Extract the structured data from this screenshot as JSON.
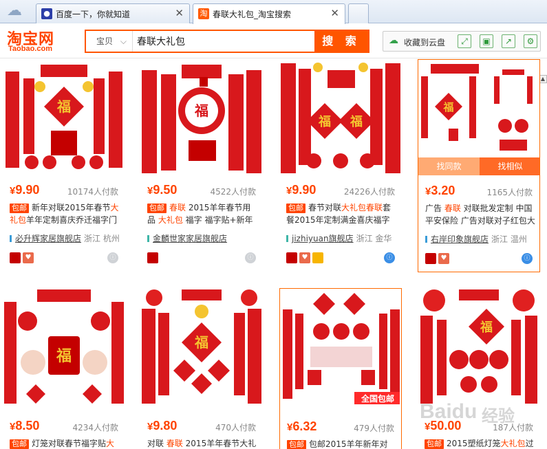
{
  "tabs": [
    {
      "title": "百度一下，你就知道",
      "icon": "baidu-paw-icon"
    },
    {
      "title": "春联大礼包_淘宝搜索",
      "icon": "taobao-icon",
      "active": true
    }
  ],
  "header": {
    "logo_cn": "淘宝网",
    "logo_en": "Taobao.com",
    "category": "宝贝",
    "query": "春联大礼包",
    "search_button": "搜 索",
    "cloud_save": "收藏到云盘"
  },
  "products": [
    {
      "price": "9.90",
      "sales": "10174人付款",
      "tag": "包邮",
      "desc_pre": "新年对联2015年春节",
      "desc_hi": "大",
      "desc_post": "",
      "desc2_hi": "礼包",
      "desc2": "羊年定制喜庆乔迁福字门",
      "shop": "必升辉家居旗舰店",
      "loc": "浙江 杭州",
      "icons": [
        "tmall",
        "heart"
      ],
      "ww": "gray"
    },
    {
      "price": "9.50",
      "sales": "4522人付款",
      "tag": "包邮",
      "desc_pre": "",
      "desc_hi": "春联",
      "desc_post": " 2015羊年春节用品",
      "desc2_hi": "大礼包",
      "desc2": " 福字 福字贴+新年红包",
      "shop": "金麟世家家居旗舰店",
      "loc": "",
      "icons": [
        "tmall"
      ],
      "ww": "gray"
    },
    {
      "price": "9.90",
      "sales": "24226人付款",
      "tag": "包邮",
      "desc_pre": "春节对联",
      "desc_hi": "大礼包春联",
      "desc_post": "套",
      "desc2_hi": "",
      "desc2": "餐2015年定制满金喜庆福字",
      "shop": "jizhiyuan旗舰店",
      "loc": "浙江 金华",
      "icons": [
        "tmall",
        "heart",
        "gold"
      ],
      "ww": "blue"
    },
    {
      "price": "3.20",
      "sales": "1165人付款",
      "tag": "",
      "desc_pre": "广告 ",
      "desc_hi": "春联",
      "desc_post": " 对联批发定制 中国",
      "desc2_hi": "",
      "desc2": "平安保险 广告对联对子红包大",
      "shop": "右岸印象旗舰店",
      "loc": "浙江 温州",
      "icons": [
        "tmall",
        "heart"
      ],
      "ww": "blue",
      "overlay": [
        "找同款",
        "找相似"
      ]
    },
    {
      "price": "8.50",
      "sales": "4234人付款",
      "tag": "包邮",
      "desc_pre": "灯笼对联春节福字贴",
      "desc_hi": "大",
      "desc_post": ""
    },
    {
      "price": "9.80",
      "sales": "470人付款",
      "tag": "",
      "desc_pre": "对联 ",
      "desc_hi": "春联",
      "desc_post": " 2015羊年春节大礼"
    },
    {
      "price": "6.32",
      "sales": "479人付款",
      "tag": "包邮",
      "desc_pre": "包邮2015羊年新年对",
      "desc_hi": "",
      "desc_post": "",
      "img_text": "全国包邮"
    },
    {
      "price": "50.00",
      "sales": "187人付款",
      "tag": "包邮",
      "desc_pre": "2015塑纸灯笼",
      "desc_hi": "大礼包",
      "desc_post": "过"
    }
  ],
  "watermark": {
    "text": "Baidu",
    "text_cn": "经验"
  },
  "colors": {
    "accent": "#ff4400",
    "search": "#ff5500",
    "red": "#d8181c",
    "gold": "#f4c430"
  }
}
